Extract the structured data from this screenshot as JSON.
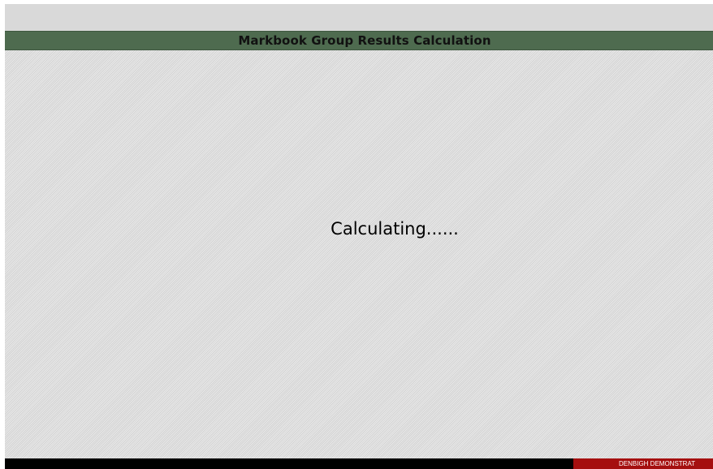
{
  "header": {
    "title": "Markbook Group Results Calculation"
  },
  "main": {
    "status_message": "Calculating......"
  },
  "footer": {
    "badge_text": "DENBIGH DEMONSTRAT"
  },
  "colors": {
    "title_bar": "#4e6b4f",
    "background": "#dcdcdc",
    "footer": "#000000",
    "footer_badge": "#a50f0f"
  }
}
